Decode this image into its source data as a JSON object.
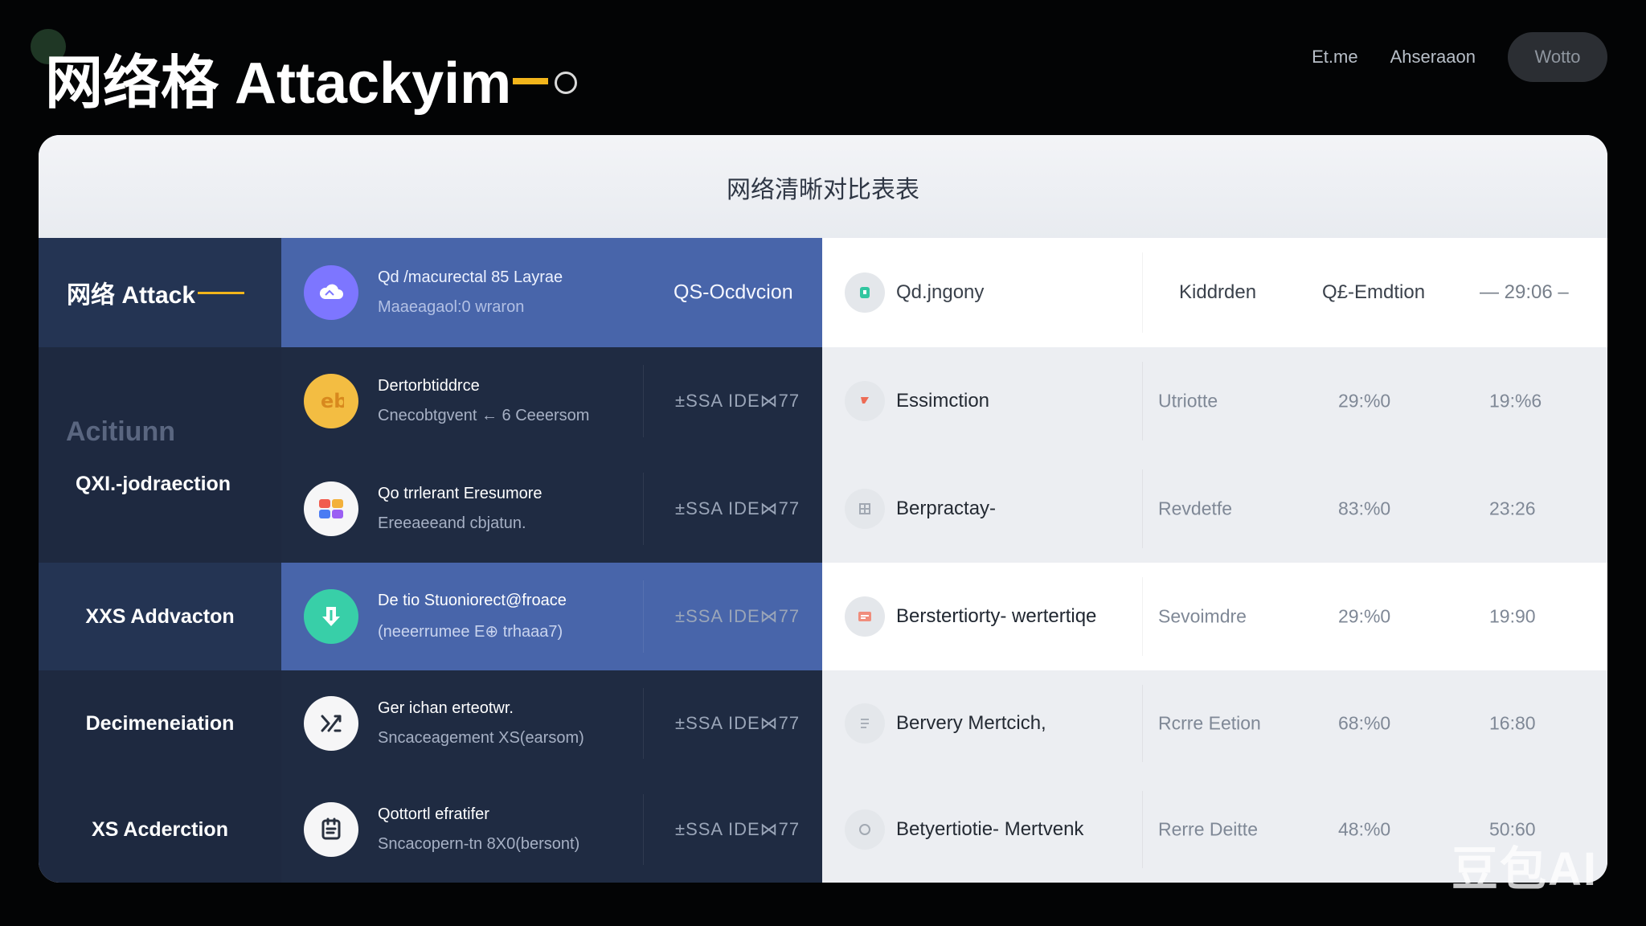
{
  "header": {
    "title": "网络格 Attackyim",
    "nav": [
      "Et.me",
      "Ahseraaon",
      "Wotto"
    ]
  },
  "card": {
    "title": "网络清晰对比表表"
  },
  "rows": [
    {
      "left": "网络 Attack",
      "main_title": "Qd /macurectal 85 Layrae",
      "main_sub": "Maaeagaol:0 wraron",
      "code": "QS-Ocdvcion",
      "right_title": "Qd.jngony",
      "right_col1": "Kiddrden",
      "right_col2": "Q£-Emdtion",
      "right_col3": "— 29:06 –",
      "icon": "cloud-icon",
      "color": "#7d76ff"
    },
    {
      "left": "Acitiunn",
      "main_title": "Dertorbtiddrce",
      "main_sub": "Cnecobtgvent ← 6 Ceeersom",
      "code": "±SSA IDE⋈77",
      "right_title": "Essimction",
      "right_col1": "Utriotte",
      "right_col2": "29:%0",
      "right_col3": "19:%6",
      "icon": "eb-icon",
      "color": "#f3bd42"
    },
    {
      "left": "QXI.-jodraection",
      "main_title": "Qo trrlerant Eresumore",
      "main_sub": "Ereeaeeand cbjatun.",
      "code": "±SSA IDE⋈77",
      "right_title": "Berpractay-",
      "right_col1": "Revdetfe",
      "right_col2": "83:%0",
      "right_col3": "23:26",
      "icon": "grid-icon",
      "color": "#f6f6f7"
    },
    {
      "left": "XXS Addvacton",
      "main_title": "De tio Stuoniorect@froace",
      "main_sub": "(neeerrumee E⊕ trhaaa7)",
      "code": "±SSA IDE⋈77",
      "right_title": "Berstertiorty- wertertiqe",
      "right_col1": "Sevoimdre",
      "right_col2": "29:%0",
      "right_col3": "19:90",
      "icon": "download-icon",
      "color": "#38cfa8"
    },
    {
      "left": "Decimeneiation",
      "main_title": "Ger ichan erteotwr.",
      "main_sub": "Sncaceagement XS(earsom)",
      "code": "±SSA IDE⋈77",
      "right_title": "Bervery Mertcich,",
      "right_col1": "Rcrre Eetion",
      "right_col2": "68:%0",
      "right_col3": "16:80",
      "icon": "shuffle-icon",
      "color": "#f6f6f7"
    },
    {
      "left": "XS Acderction",
      "main_title": "Qottortl efratifer",
      "main_sub": "Sncacopern-tn 8X0(bersont)",
      "code": "±SSA IDE⋈77",
      "right_title": "Betyertiotie- Mertvenk",
      "right_col1": "Rerre Deitte",
      "right_col2": "48:%0",
      "right_col3": "50:60",
      "icon": "document-icon",
      "color": "#f6f6f7"
    }
  ],
  "watermark": "豆包AI"
}
